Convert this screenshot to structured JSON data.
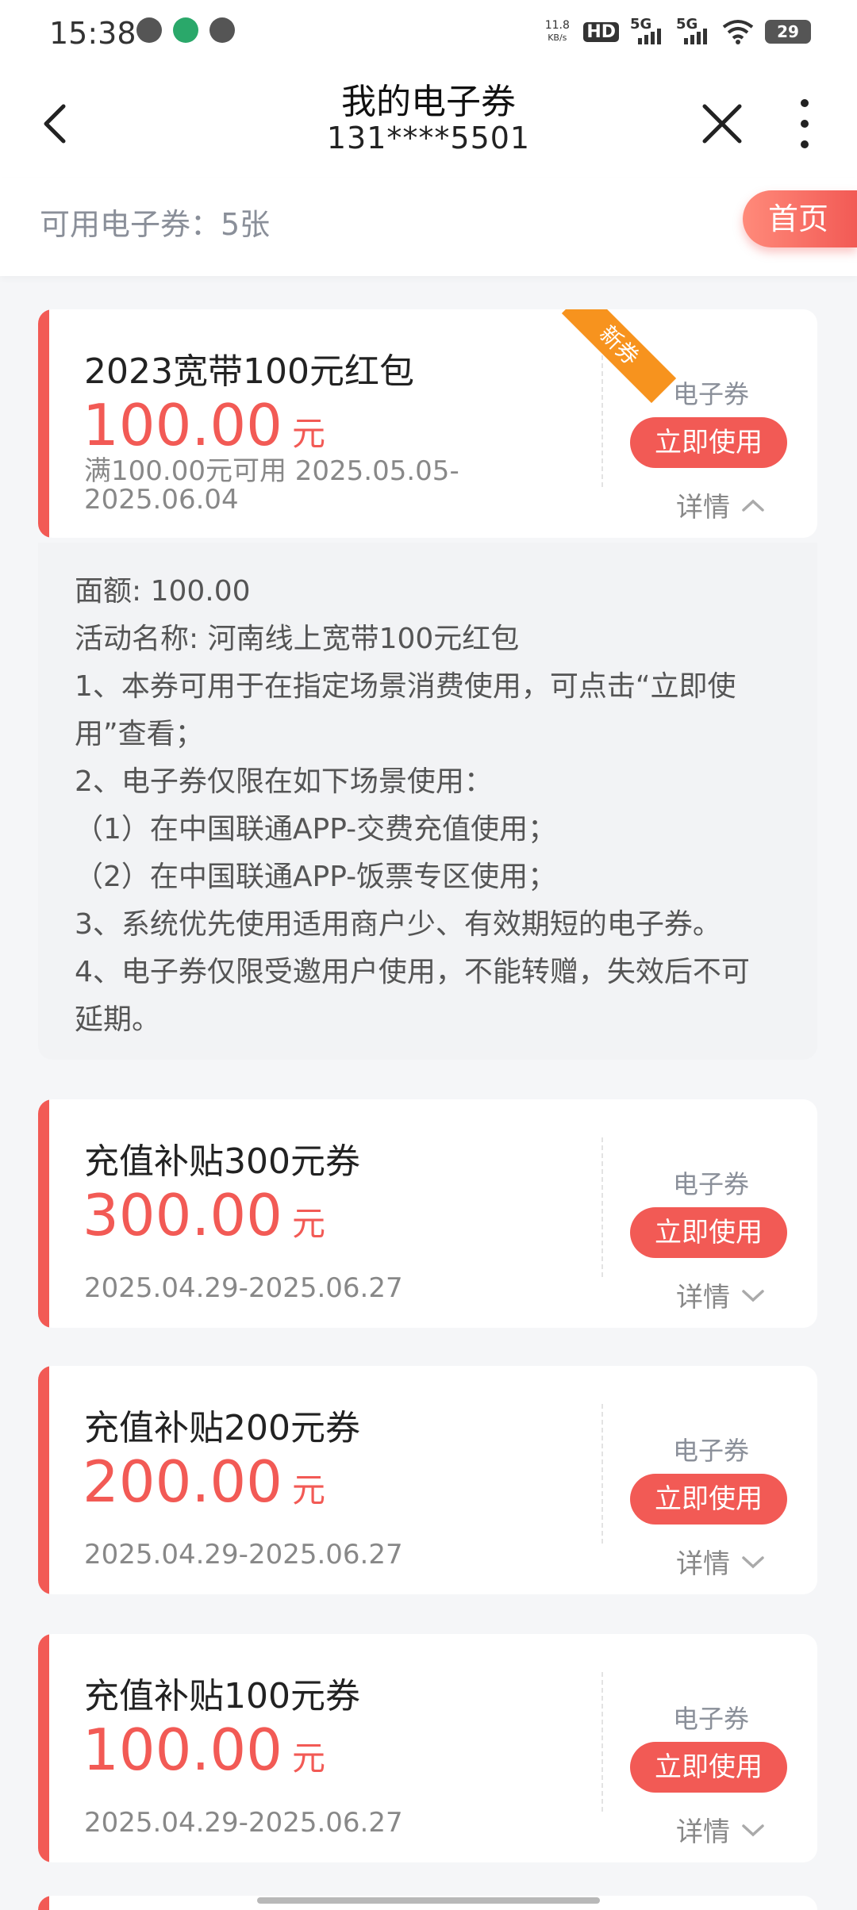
{
  "status_bar": {
    "time": "15:38",
    "net_speed_value": "11.8",
    "net_speed_unit": "KB/s",
    "hd_label": "HD",
    "sim1_label": "5G",
    "sim2_label": "5G",
    "battery": "29"
  },
  "header": {
    "title": "我的电子券",
    "phone": "131****5501"
  },
  "summary": {
    "available_text": "可用电子券：5张",
    "home_button": "首页"
  },
  "coupons": [
    {
      "name": "2023宽带100元红包",
      "amount": "100.00",
      "unit": "元",
      "validity": "满100.00元可用 2025.05.05-2025.06.04",
      "type": "电子券",
      "use_label": "立即使用",
      "detail_label": "详情",
      "expanded": true,
      "badge": "新券"
    },
    {
      "name": "充值补贴300元券",
      "amount": "300.00",
      "unit": "元",
      "validity": "2025.04.29-2025.06.27",
      "type": "电子券",
      "use_label": "立即使用",
      "detail_label": "详情",
      "expanded": false
    },
    {
      "name": "充值补贴200元券",
      "amount": "200.00",
      "unit": "元",
      "validity": "2025.04.29-2025.06.27",
      "type": "电子券",
      "use_label": "立即使用",
      "detail_label": "详情",
      "expanded": false
    },
    {
      "name": "充值补贴100元券",
      "amount": "100.00",
      "unit": "元",
      "validity": "2025.04.29-2025.06.27",
      "type": "电子券",
      "use_label": "立即使用",
      "detail_label": "详情",
      "expanded": false
    }
  ],
  "details": {
    "lines": [
      "面额: 100.00",
      "活动名称: 河南线上宽带100元红包",
      "1、本券可用于在指定场景消费使用，可点击“立即使",
      "用”查看；",
      "2、电子券仅限在如下场景使用：",
      "（1）在中国联通APP-交费充值使用；",
      "（2）在中国联通APP-饭票专区使用；",
      "3、系统优先使用适用商户少、有效期短的电子券。",
      "4、电子券仅限受邀用户使用，不能转赠，失效后不可",
      "延期。"
    ]
  },
  "colors": {
    "accent": "#f25a55",
    "badge": "#f7931e",
    "muted_text": "#8a8f99",
    "panel_bg": "#f2f3f5"
  }
}
